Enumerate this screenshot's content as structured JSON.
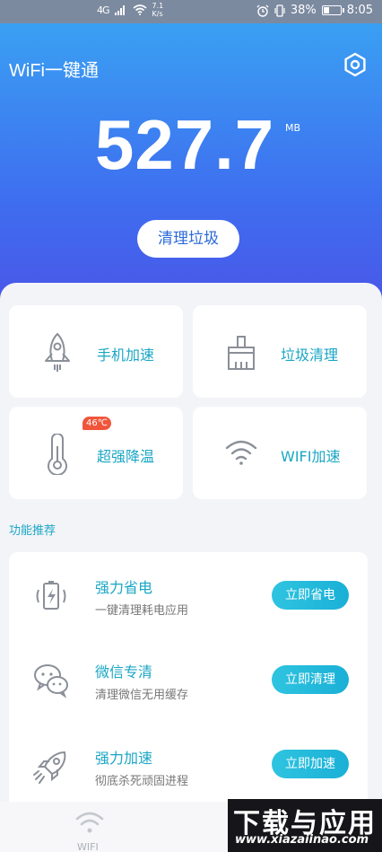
{
  "status_bar": {
    "signal": "4G",
    "net_speed_value": "7.1",
    "net_speed_unit": "K/s",
    "battery": "38%",
    "battery_level": 0.38,
    "time": "8:05"
  },
  "header": {
    "app_title": "WiFi一键通",
    "value": "527.7",
    "unit": "MB",
    "clean_button": "清理垃圾",
    "settings_icon": "gear-hex-icon"
  },
  "tools": [
    {
      "label": "手机加速",
      "icon": "rocket-icon"
    },
    {
      "label": "垃圾清理",
      "icon": "broom-icon"
    },
    {
      "label": "超强降温",
      "icon": "thermometer-icon",
      "badge": "46℃"
    },
    {
      "label": "WIFI加速",
      "icon": "wifi-icon"
    }
  ],
  "recommend": {
    "title": "功能推荐",
    "items": [
      {
        "title": "强力省电",
        "subtitle": "一键清理耗电应用",
        "button": "立即省电",
        "icon": "battery-charge-icon"
      },
      {
        "title": "微信专清",
        "subtitle": "清理微信无用缓存",
        "button": "立即清理",
        "icon": "wechat-icon"
      },
      {
        "title": "强力加速",
        "subtitle": "彻底杀死顽固进程",
        "button": "立即加速",
        "icon": "rocket-launch-icon"
      }
    ]
  },
  "bottom_nav": {
    "wifi_label": "WIFI"
  },
  "watermark": {
    "main": "下载与应用",
    "url": "www.xiazaiinao.com"
  },
  "colors": {
    "accent": "#1aa6c4",
    "header_top": "#3aa0f2",
    "header_bottom": "#4a55e8",
    "badge": "#f0553b"
  }
}
